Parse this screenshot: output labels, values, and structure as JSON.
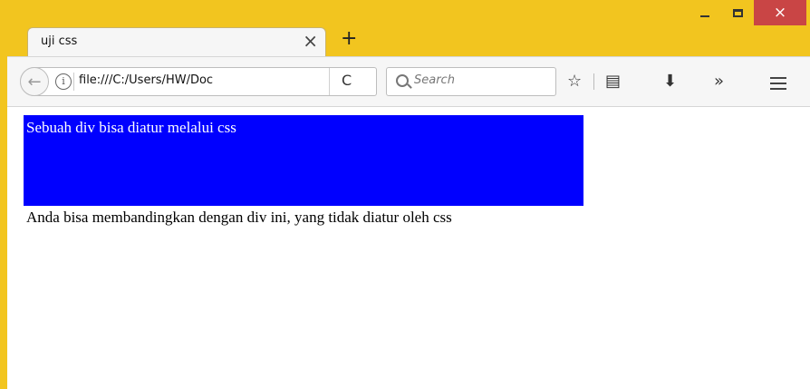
{
  "browser": {
    "tab": {
      "title": "uji css",
      "close_glyph": "×"
    },
    "new_tab_glyph": "+",
    "window_controls": {
      "close_glyph": "×"
    },
    "toolbar": {
      "back_glyph": "←",
      "info_glyph": "i",
      "url": "file:///C:/Users/HW/Doc",
      "reload_glyph": "C",
      "search_placeholder": "Search",
      "bookmark_glyph": "☆",
      "reading_glyph": "▤",
      "download_glyph": "⬇",
      "overflow_glyph": "»"
    }
  },
  "page": {
    "styled_div_text": "Sebuah div bisa diatur melalui css",
    "plain_div_text": "Anda bisa membandingkan dengan div ini, yang tidak diatur oleh css",
    "styled_div_color": "#0000ff"
  },
  "colors": {
    "frame": "#f2c51f",
    "close_button": "#c94545"
  }
}
